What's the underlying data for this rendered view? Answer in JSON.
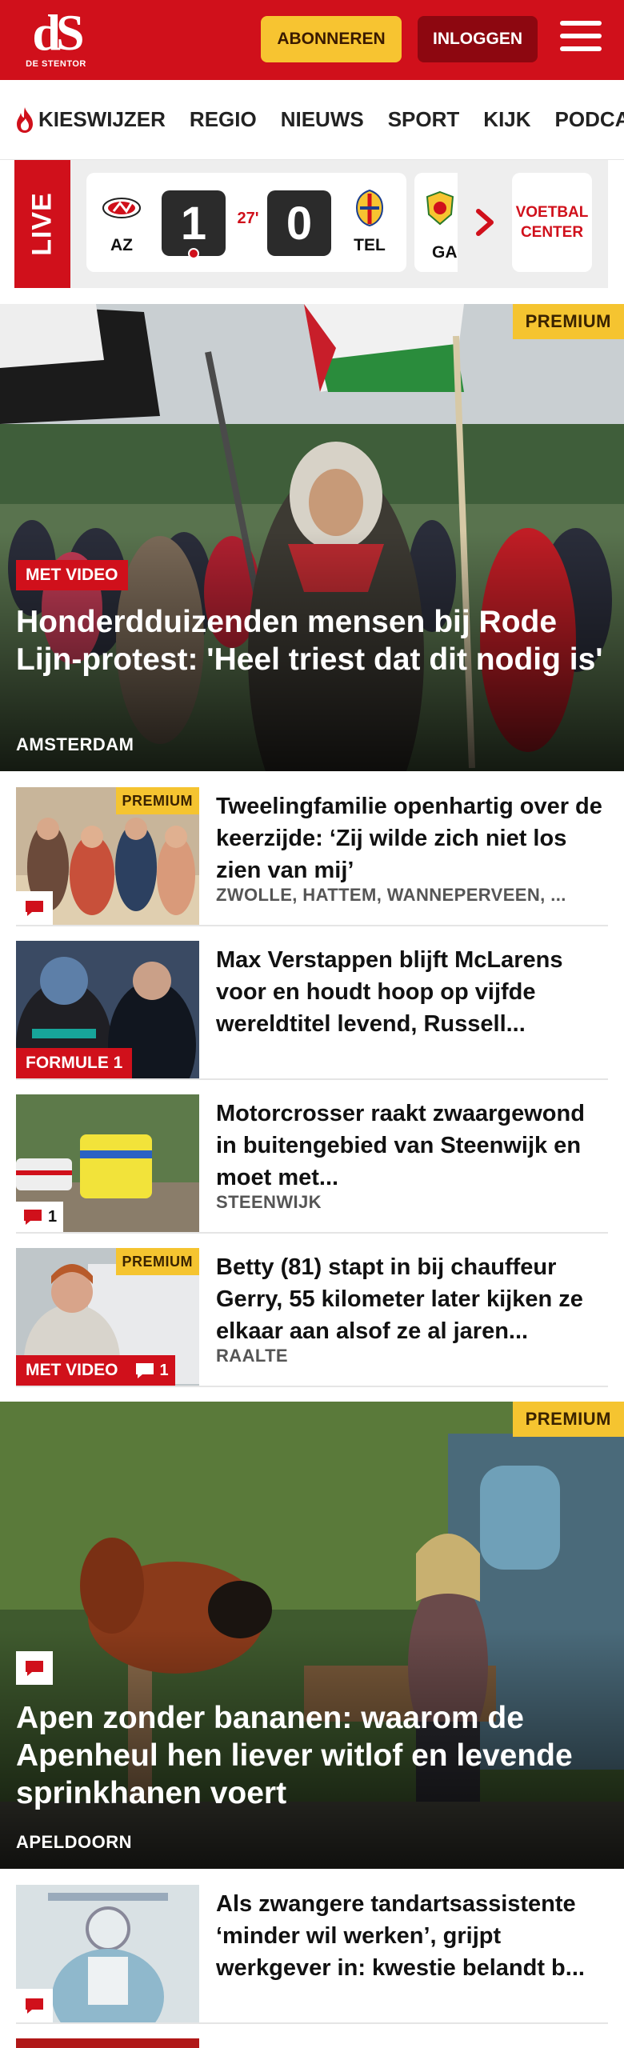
{
  "header": {
    "logo_mark": "dS",
    "logo_name": "DE STENTOR",
    "subscribe_label": "ABONNEREN",
    "login_label": "INLOGGEN",
    "menu_icon": "hamburger-icon",
    "brand_color": "#d0101b"
  },
  "nav": {
    "items": [
      {
        "label": "KIESWIJZER",
        "icon": "flame-icon"
      },
      {
        "label": "REGIO"
      },
      {
        "label": "NIEUWS"
      },
      {
        "label": "SPORT"
      },
      {
        "label": "KIJK"
      },
      {
        "label": "PODCASTS"
      }
    ]
  },
  "live": {
    "label": "LIVE",
    "match": {
      "home": "AZ",
      "away": "TEL",
      "home_score": "1",
      "away_score": "0",
      "minute": "27'"
    },
    "next_match_home": "GA",
    "football_center_label": "VOETBAL CENTER"
  },
  "hero1": {
    "premium": "PREMIUM",
    "tag": "MET VIDEO",
    "title": "Honderdduizenden mensen bij Rode Lijn-protest: 'Heel triest dat dit nodig is'",
    "location": "AMSTERDAM"
  },
  "articles": [
    {
      "premium": "PREMIUM",
      "title": "Tweelingfamilie openhartig over de keerzijde: ‘Zij wilde zich niet los zien van mij’",
      "location": "ZWOLLE, HATTEM, WANNEPERVEEN, ..."
    },
    {
      "tag": "FORMULE 1",
      "title": "Max Verstappen blijft McLarens voor en houdt hoop op vijfde wereldtitel levend, Russell..."
    },
    {
      "comments": "1",
      "title": "Motorcrosser raakt zwaargewond in buitengebied van Steenwijk en moet met...",
      "location": "STEENWIJK"
    },
    {
      "premium": "PREMIUM",
      "tag": "MET VIDEO",
      "comments": "1",
      "title": "Betty (81) stapt in bij chauffeur Gerry, 55 kilometer later kijken ze elkaar aan alsof ze al jaren...",
      "location": "RAALTE"
    }
  ],
  "hero2": {
    "premium": "PREMIUM",
    "title": "Apen zonder bananen: waarom de Apenheul hen liever witlof en levende sprinkhanen voert",
    "location": "APELDOORN"
  },
  "article_last": {
    "title": "Als zwangere tandartsassistente ‘minder wil werken’, grijpt werkgever in: kwestie belandt b..."
  }
}
